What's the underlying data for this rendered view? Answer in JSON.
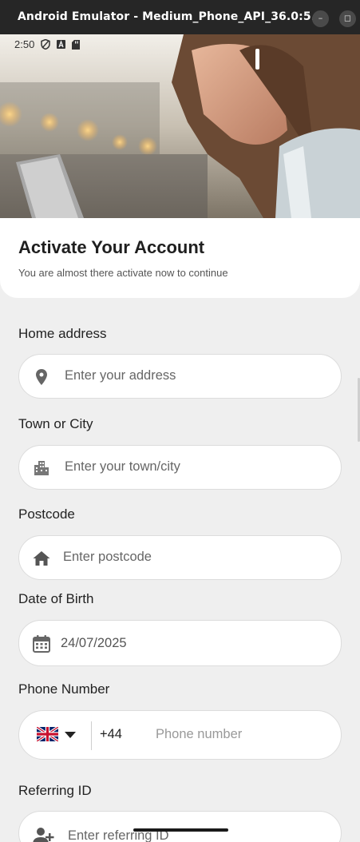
{
  "window": {
    "title": "Android Emulator - Medium_Phone_API_36.0:5...",
    "minimize_glyph": "–",
    "maximize_glyph": "◻"
  },
  "status_bar": {
    "time": "2:50"
  },
  "header": {
    "title": "Activate Your Account",
    "subtitle": "You are almost there activate now to continue"
  },
  "form": {
    "home_address": {
      "label": "Home address",
      "placeholder": "Enter your address",
      "icon": "location-pin-icon"
    },
    "town_city": {
      "label": "Town or City",
      "placeholder": "Enter your town/city",
      "icon": "city-icon"
    },
    "postcode": {
      "label": "Postcode",
      "placeholder": "Enter postcode",
      "icon": "home-icon"
    },
    "date_of_birth": {
      "label": "Date of Birth",
      "value": "24/07/2025",
      "icon": "calendar-icon"
    },
    "phone": {
      "label": "Phone Number",
      "country_code": "+44",
      "placeholder": "Phone number",
      "flag": "uk-flag-icon"
    },
    "referring_id": {
      "label": "Referring ID",
      "placeholder": "Enter referring ID",
      "icon": "add-person-icon"
    }
  },
  "colors": {
    "background": "#efefef",
    "card": "#ffffff",
    "title": "#1f1f1f"
  }
}
